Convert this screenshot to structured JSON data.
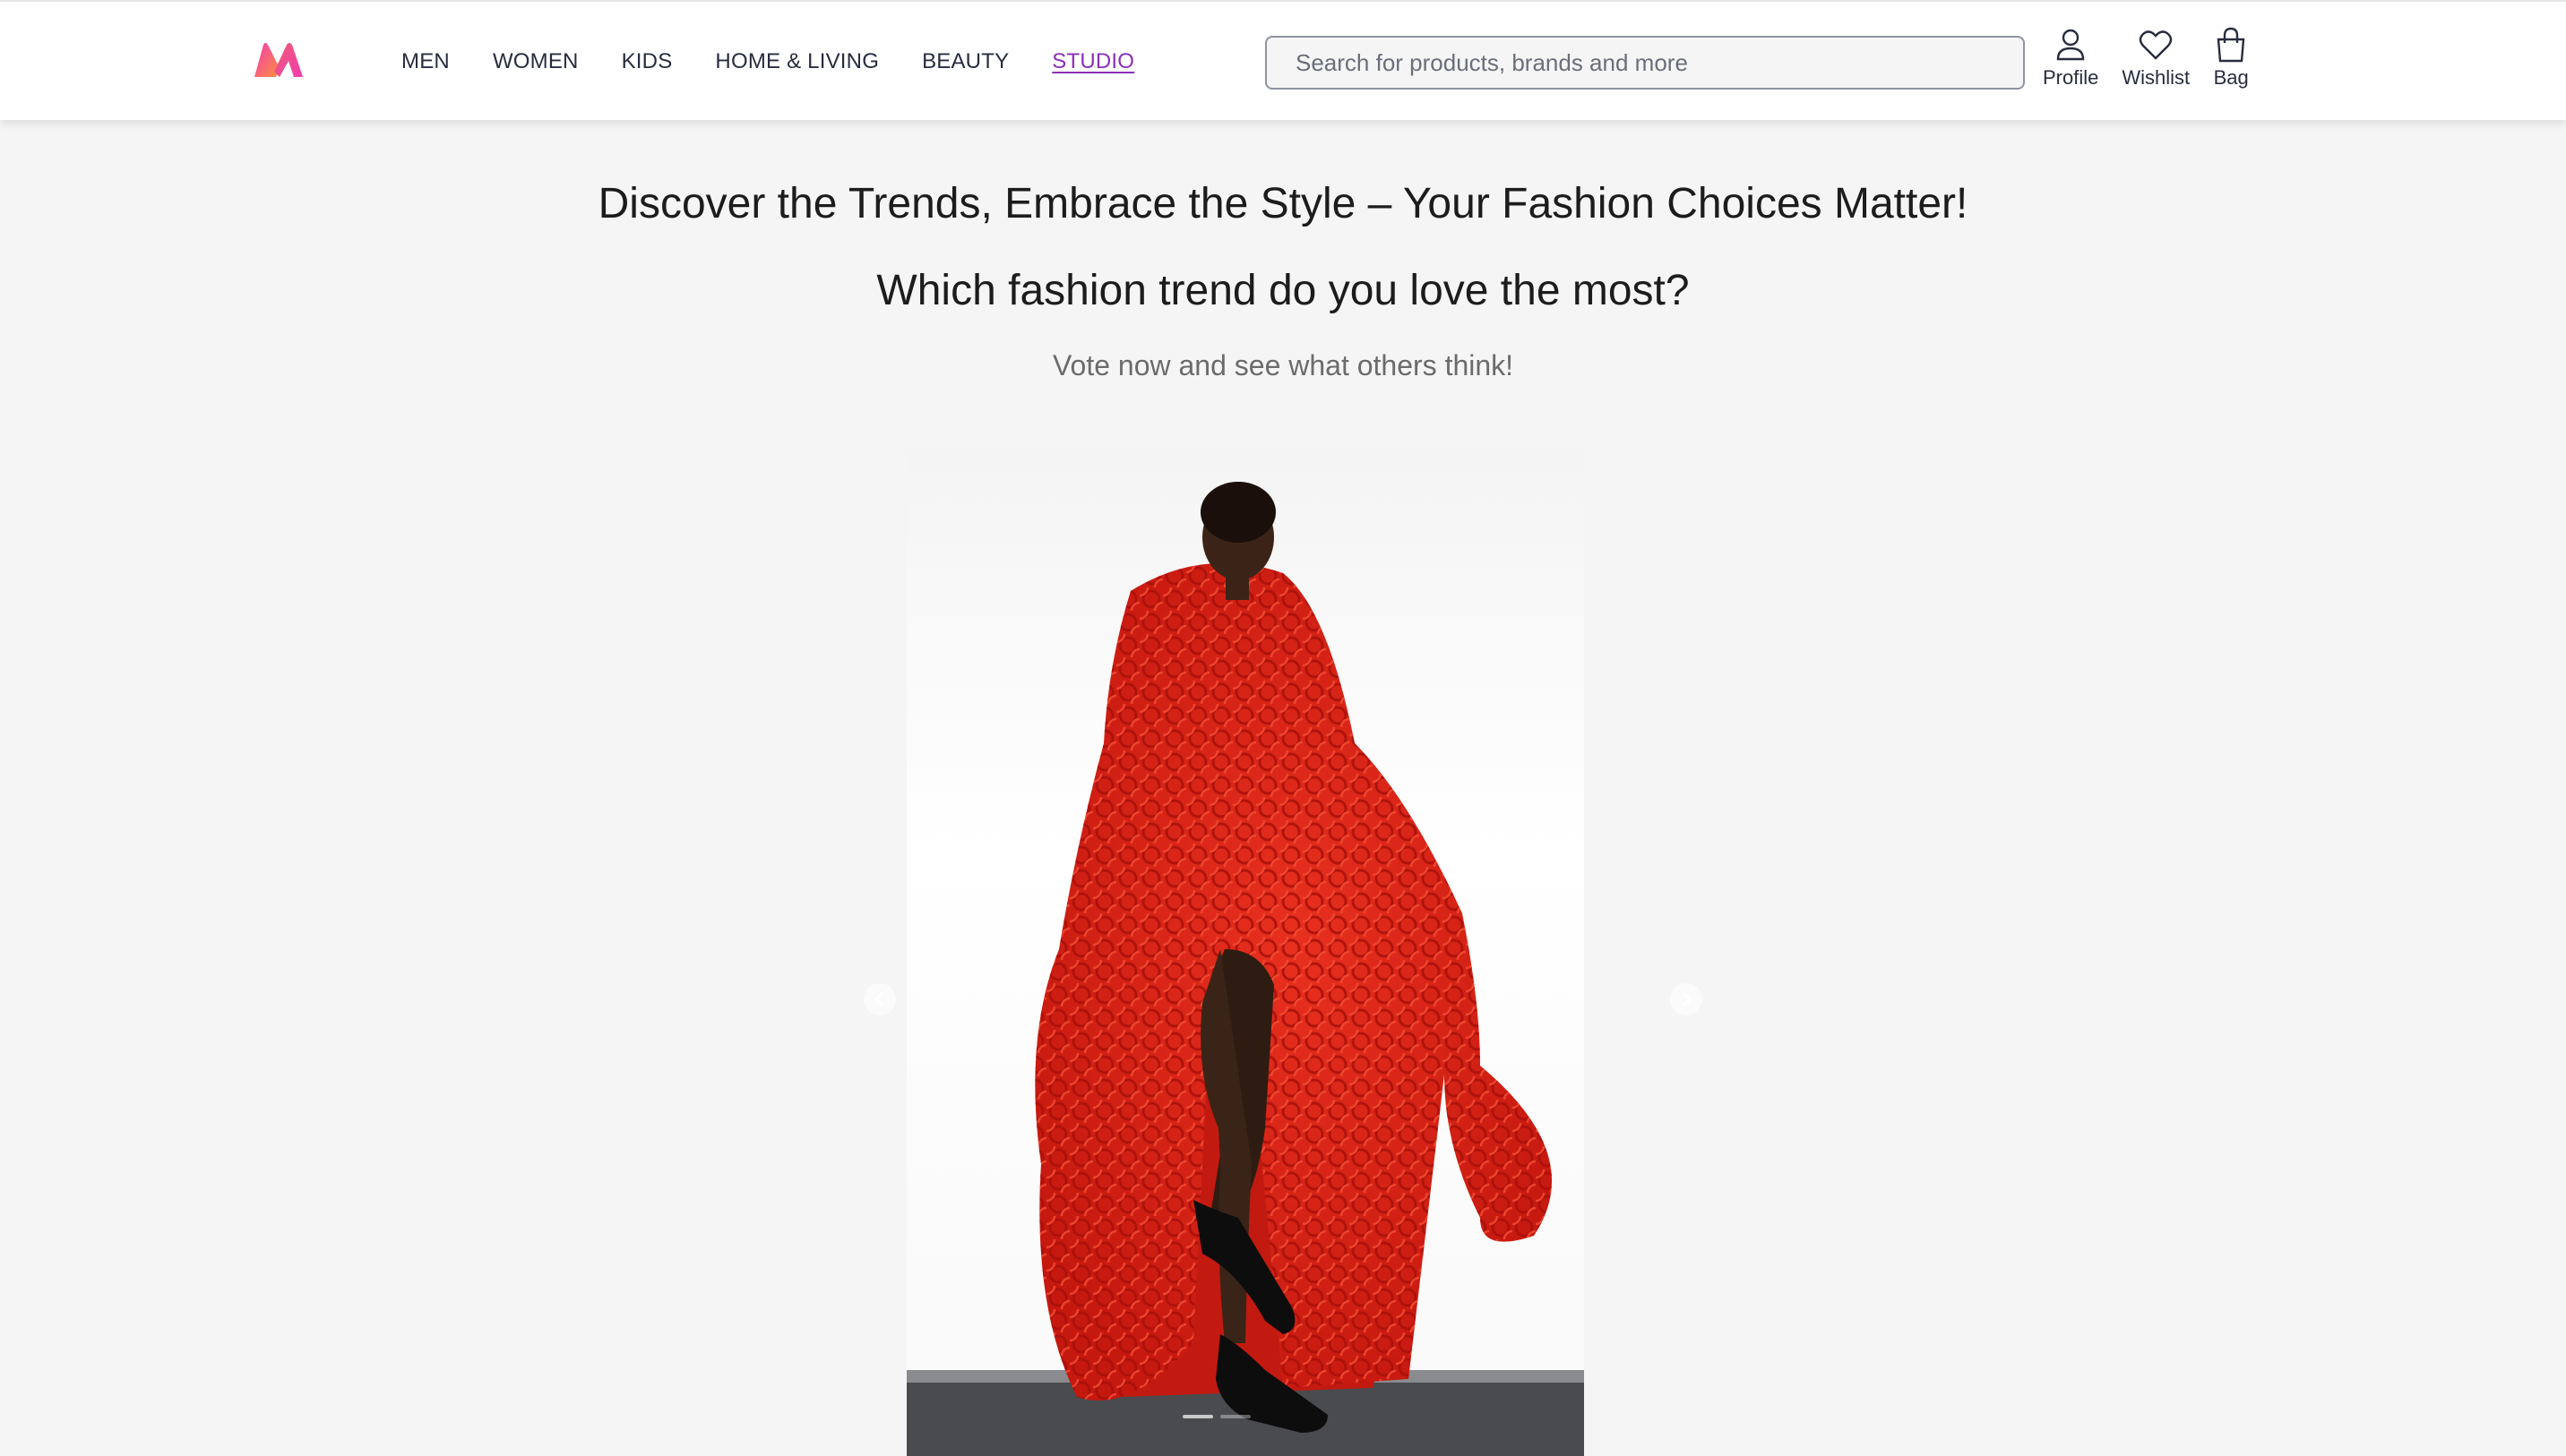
{
  "brand": {
    "name": "Myntra",
    "logo_icon": "myntra-logo-icon"
  },
  "nav": {
    "items": [
      {
        "label": "MEN",
        "active": false
      },
      {
        "label": "WOMEN",
        "active": false
      },
      {
        "label": "KIDS",
        "active": false
      },
      {
        "label": "HOME & LIVING",
        "active": false
      },
      {
        "label": "BEAUTY",
        "active": false
      },
      {
        "label": "STUDIO",
        "active": true
      }
    ]
  },
  "search": {
    "placeholder": "Search for products, brands and more",
    "value": ""
  },
  "actions": {
    "profile": {
      "label": "Profile",
      "icon": "profile-icon"
    },
    "wishlist": {
      "label": "Wishlist",
      "icon": "heart-icon"
    },
    "bag": {
      "label": "Bag",
      "icon": "bag-icon"
    }
  },
  "poll": {
    "headline": "Discover the Trends, Embrace the Style – Your Fashion Choices Matter!",
    "question": "Which fashion trend do you love the most?",
    "subtext": "Vote now and see what others think!"
  },
  "carousel": {
    "image_alt": "Model wearing a red looped knit coat and black heels",
    "prev_icon": "chevron-left-icon",
    "next_icon": "chevron-right-icon",
    "slides": 2,
    "active_slide": 1
  },
  "colors": {
    "accent": "#8b2fb8",
    "coat_red": "#e0241c",
    "background": "#f5f5f6"
  }
}
